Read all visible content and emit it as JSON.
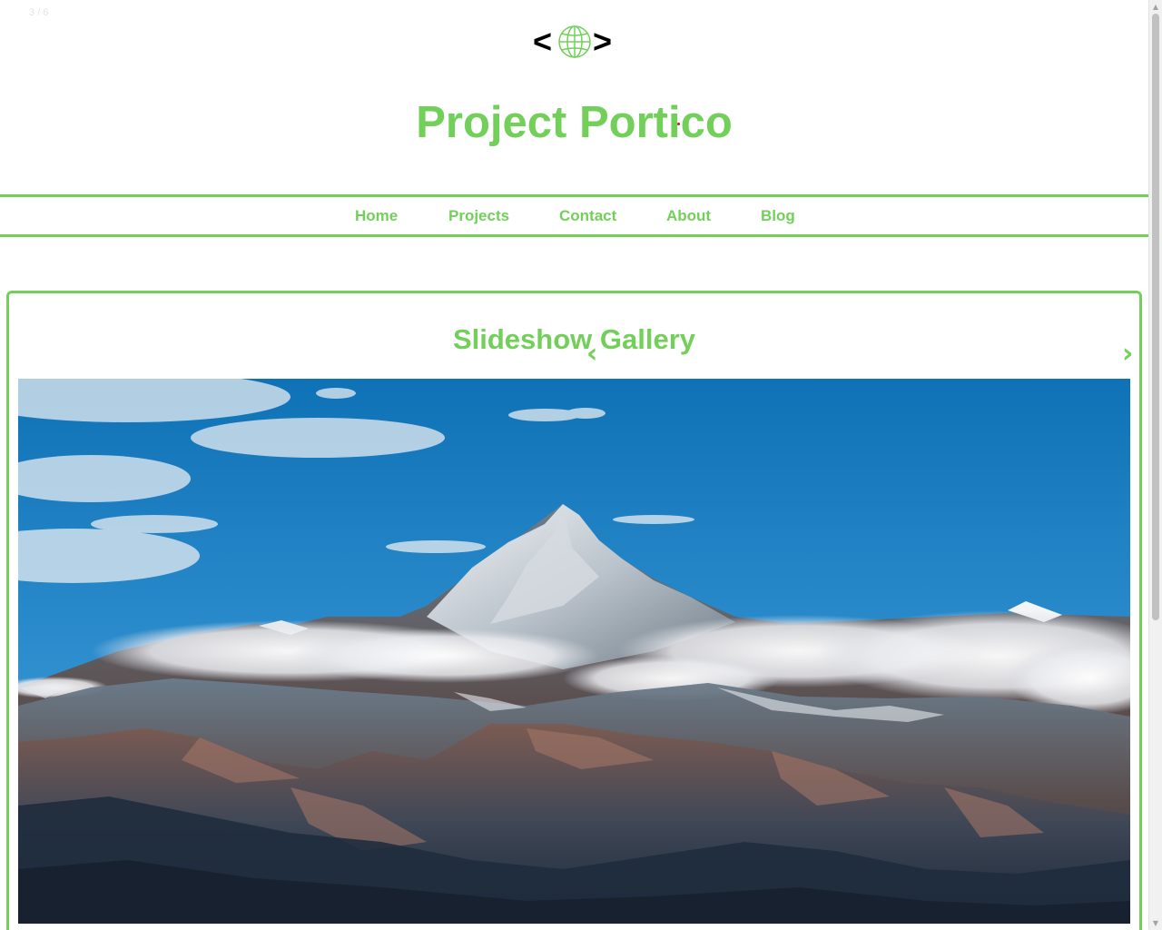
{
  "slideshow": {
    "counter_text": "3 / 6",
    "title": "Slideshow Gallery",
    "prev_arrow": "‹",
    "next_arrow": "›",
    "image_alt": "mountain-landscape",
    "current_slide": 3,
    "total_slides": 6
  },
  "header": {
    "logo_left": "<",
    "logo_right": ">",
    "logo_icon": "globe-icon",
    "title": "Project Portico"
  },
  "nav": {
    "items": [
      {
        "label": "Home"
      },
      {
        "label": "Projects"
      },
      {
        "label": "Contact"
      },
      {
        "label": "About"
      },
      {
        "label": "Blog"
      }
    ]
  },
  "scrollbar": {
    "up_glyph": "▲",
    "down_glyph": "▼"
  },
  "colors": {
    "accent": "#72d05a",
    "background": "#ffffff"
  }
}
